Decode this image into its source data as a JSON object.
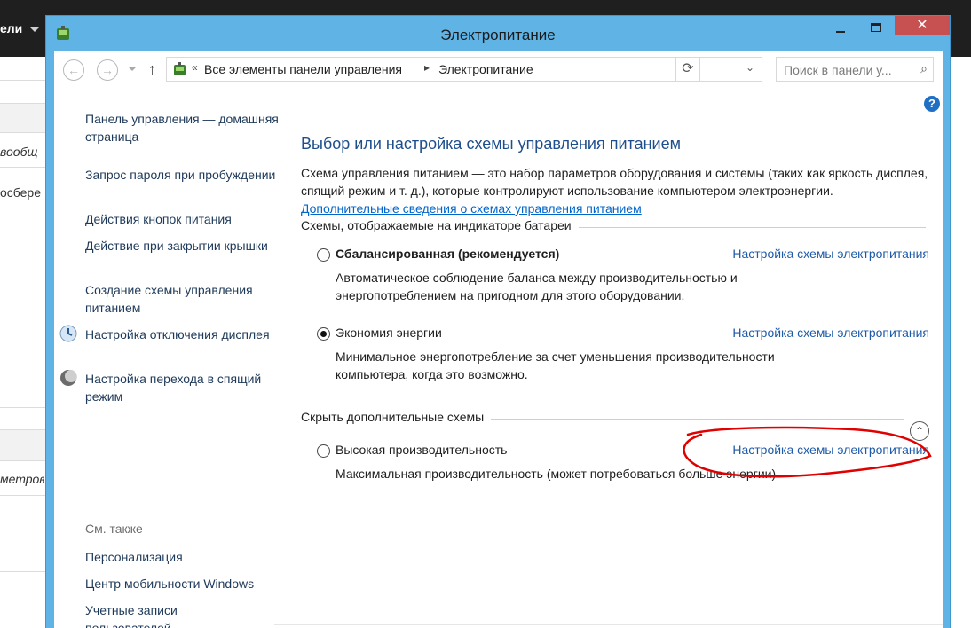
{
  "background_app": {
    "title": "ели",
    "texts": [
      "вообщ",
      "осбере",
      "метров"
    ]
  },
  "window": {
    "title": "Электропитание",
    "close_label": "✕"
  },
  "navbar": {
    "breadcrumb": [
      "Все элементы панели управления",
      "Электропитание"
    ],
    "breadcrumb_prefix": "«",
    "search_placeholder": "Поиск в панели у..."
  },
  "left_nav": {
    "links": [
      "Панель управления — домашняя страница",
      "Запрос пароля при пробуждении",
      "Действия кнопок питания",
      "Действие при закрытии крышки",
      "Создание схемы управления питанием",
      "Настройка отключения дисплея",
      "Настройка перехода в спящий режим"
    ],
    "see_also_label": "См. также",
    "see_also": [
      "Персонализация",
      "Центр мобильности Windows",
      "Учетные записи пользователей"
    ]
  },
  "main": {
    "title": "Выбор или настройка схемы управления питанием",
    "description": "Схема управления питанием — это набор параметров оборудования и системы (таких как яркость дисплея, спящий режим и т. д.), которые контролируют использование компьютером электроэнергии.",
    "description_link": "Дополнительные сведения о схемах управления питанием",
    "section_battery": "Схемы, отображаемые на индикаторе батареи",
    "section_hidden": "Скрыть дополнительные схемы",
    "plans": [
      {
        "name": "Сбалансированная (рекомендуется)",
        "link": "Настройка схемы электропитания",
        "description": "Автоматическое соблюдение баланса между производительностью и энергопотреблением на пригодном для этого оборудовании.",
        "selected": false
      },
      {
        "name": "Экономия энергии",
        "link": "Настройка схемы электропитания",
        "description": "Минимальное энергопотребление за счет уменьшения производительности компьютера, когда это возможно.",
        "selected": true
      },
      {
        "name": "Высокая производительность",
        "link": "Настройка схемы электропитания",
        "description": "Максимальная производительность (может потребоваться больше энергии)",
        "selected": false
      }
    ]
  },
  "colors": {
    "window_frame": "#5fb3e5",
    "close_button": "#c75050",
    "link": "#1e5aa8",
    "title": "#1e4e8c",
    "annotation": "#e00000"
  }
}
